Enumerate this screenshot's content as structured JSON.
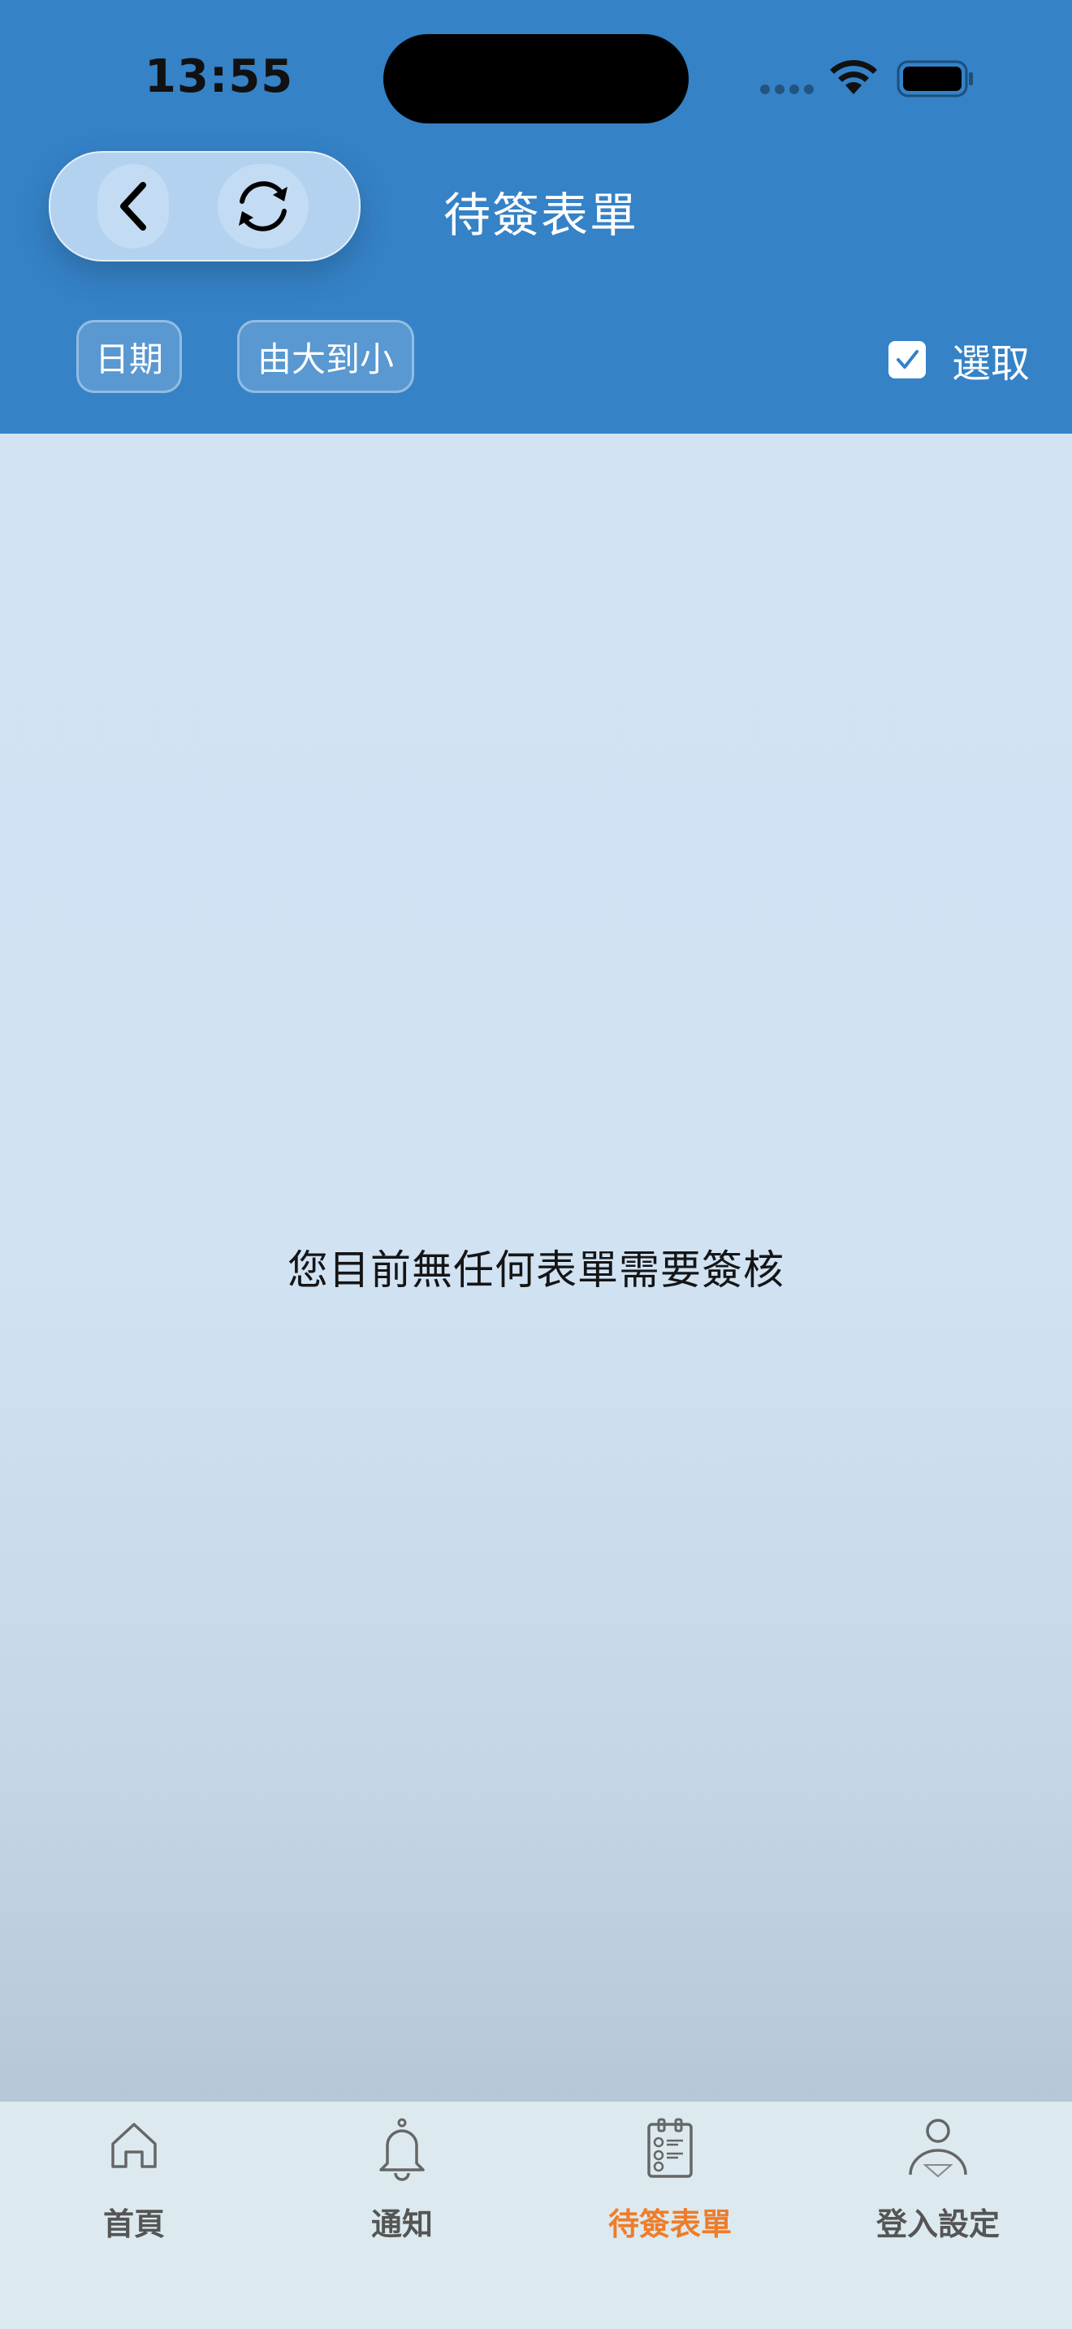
{
  "status_bar": {
    "time": "13:55"
  },
  "header": {
    "title": "待簽表單",
    "back_icon": "chevron-left-icon",
    "refresh_icon": "refresh-icon"
  },
  "filters": {
    "date_chip": "日期",
    "sort_chip": "由大到小",
    "select_label": "選取",
    "select_checked": true
  },
  "content": {
    "empty_message": "您目前無任何表單需要簽核"
  },
  "tabbar": {
    "items": [
      {
        "label": "首頁",
        "icon": "home-icon",
        "active": false
      },
      {
        "label": "通知",
        "icon": "bell-icon",
        "active": false
      },
      {
        "label": "待簽表單",
        "icon": "clipboard-icon",
        "active": true
      },
      {
        "label": "登入設定",
        "icon": "user-icon",
        "active": false
      }
    ],
    "active_color": "#ef7c2a"
  },
  "colors": {
    "header_bg": "#3582c7",
    "content_bg": "#d3e3f3",
    "tabbar_bg": "#dceaef"
  }
}
